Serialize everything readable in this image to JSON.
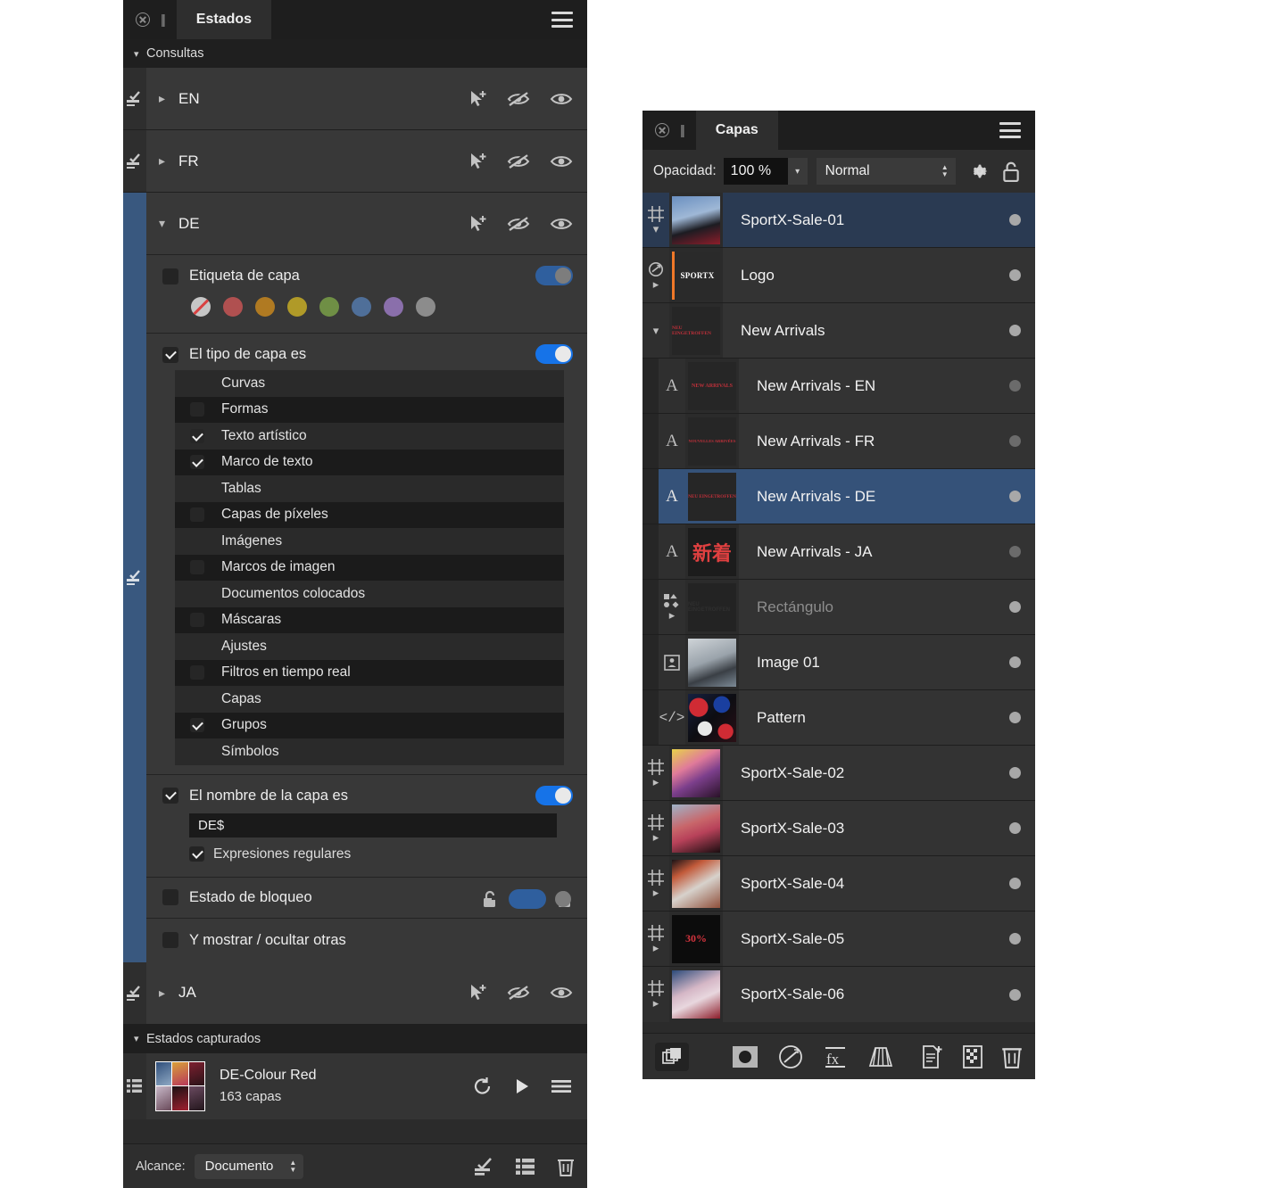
{
  "estados_panel": {
    "tab_title": "Estados",
    "sections": {
      "queries_header": "Consultas",
      "captured_header": "Estados capturados"
    },
    "queries": [
      {
        "name": "EN",
        "expanded": false,
        "selected": false
      },
      {
        "name": "FR",
        "expanded": false,
        "selected": false
      },
      {
        "name": "DE",
        "expanded": true,
        "selected": true
      },
      {
        "name": "JA",
        "expanded": false,
        "selected": false
      }
    ],
    "de_conditions": {
      "layer_label": {
        "label": "Etiqueta de capa",
        "checked": false,
        "toggle_on": false,
        "swatches": [
          "none",
          "#b05050",
          "#b07a22",
          "#b09a28",
          "#6f8f45",
          "#4f6f99",
          "#8a6fab",
          "#8c8c8c"
        ]
      },
      "layer_type": {
        "label": "El tipo de capa es",
        "checked": true,
        "toggle_on": true,
        "items": [
          {
            "label": "Curvas",
            "checked": false
          },
          {
            "label": "Formas",
            "checked": false
          },
          {
            "label": "Texto artístico",
            "checked": true
          },
          {
            "label": "Marco de texto",
            "checked": true
          },
          {
            "label": "Tablas",
            "checked": false
          },
          {
            "label": "Capas de píxeles",
            "checked": false
          },
          {
            "label": "Imágenes",
            "checked": false
          },
          {
            "label": "Marcos de imagen",
            "checked": false
          },
          {
            "label": "Documentos colocados",
            "checked": false
          },
          {
            "label": "Máscaras",
            "checked": false
          },
          {
            "label": "Ajustes",
            "checked": false
          },
          {
            "label": "Filtros en tiempo real",
            "checked": false
          },
          {
            "label": "Capas",
            "checked": false
          },
          {
            "label": "Grupos",
            "checked": true
          },
          {
            "label": "Símbolos",
            "checked": false
          }
        ]
      },
      "layer_name": {
        "label": "El nombre de la capa es",
        "checked": true,
        "toggle_on": true,
        "value": "DE$",
        "regex_label": "Expresiones regulares",
        "regex_checked": true
      },
      "lock_state": {
        "label": "Estado de bloqueo",
        "checked": false,
        "toggle_on": false
      },
      "show_hide_others": {
        "label": "Y mostrar / ocultar otras",
        "checked": false
      }
    },
    "captured_state": {
      "title": "DE-Colour Red",
      "subtitle": "163 capas"
    },
    "footer": {
      "scope_label": "Alcance:",
      "scope_value": "Documento"
    }
  },
  "capas_panel": {
    "tab_title": "Capas",
    "opacity_label": "Opacidad:",
    "opacity_value": "100 %",
    "blend_mode": "Normal",
    "layers": [
      {
        "name": "SportX-Sale-01",
        "icon": "artboard-icon",
        "indent": 0,
        "selected": true,
        "dim": false,
        "twisty": "down",
        "thumb": "photo-blue"
      },
      {
        "name": "Logo",
        "icon": "symbol-icon",
        "indent": 0,
        "selected": false,
        "dim": false,
        "twisty": "right",
        "thumb": "sportx-logo"
      },
      {
        "name": "New Arrivals",
        "icon": "none",
        "indent": 0,
        "selected": false,
        "dim": false,
        "twisty": "down",
        "thumb": "neu-eingetroffen"
      },
      {
        "name": "New Arrivals - EN",
        "icon": "text-icon",
        "indent": 1,
        "selected": false,
        "dim": false,
        "twisty": "none",
        "thumb": "new-arrivals"
      },
      {
        "name": "New Arrivals - FR",
        "icon": "text-icon",
        "indent": 1,
        "selected": false,
        "dim": false,
        "twisty": "none",
        "thumb": "nouvelles-arrivees"
      },
      {
        "name": "New Arrivals - DE",
        "icon": "text-icon",
        "indent": 1,
        "selected": true,
        "dim": false,
        "twisty": "none",
        "thumb": "neu-eingetroffen"
      },
      {
        "name": "New Arrivals - JA",
        "icon": "text-icon",
        "indent": 1,
        "selected": false,
        "dim": false,
        "twisty": "none",
        "thumb": "shinchaku"
      },
      {
        "name": "Rectángulo",
        "icon": "shapes-icon",
        "indent": 1,
        "selected": false,
        "dim": true,
        "twisty": "right",
        "thumb": "dark-empty"
      },
      {
        "name": "Image 01",
        "icon": "image-icon",
        "indent": 1,
        "selected": false,
        "dim": false,
        "twisty": "none",
        "thumb": "photo-street"
      },
      {
        "name": "Pattern",
        "icon": "code-icon",
        "indent": 1,
        "selected": false,
        "dim": false,
        "twisty": "none",
        "thumb": "pattern-collage"
      },
      {
        "name": "SportX-Sale-02",
        "icon": "artboard-icon",
        "indent": 0,
        "selected": false,
        "dim": false,
        "twisty": "right",
        "thumb": "sale-02"
      },
      {
        "name": "SportX-Sale-03",
        "icon": "artboard-icon",
        "indent": 0,
        "selected": false,
        "dim": false,
        "twisty": "right",
        "thumb": "sale-03"
      },
      {
        "name": "SportX-Sale-04",
        "icon": "artboard-icon",
        "indent": 0,
        "selected": false,
        "dim": false,
        "twisty": "right",
        "thumb": "sale-04"
      },
      {
        "name": "SportX-Sale-05",
        "icon": "artboard-icon",
        "indent": 0,
        "selected": false,
        "dim": false,
        "twisty": "right",
        "thumb": "sale-05"
      },
      {
        "name": "SportX-Sale-06",
        "icon": "artboard-icon",
        "indent": 0,
        "selected": false,
        "dim": false,
        "twisty": "right",
        "thumb": "sale-06"
      }
    ],
    "footer_icons": [
      "layer-stack-icon",
      "mask-icon",
      "adjustment-icon",
      "fx-icon",
      "blend-ranges-icon",
      "new-layer-icon",
      "new-mask-icon",
      "delete-icon"
    ]
  },
  "colors": {
    "panel_bg": "#2b2b2b",
    "row_bg": "#383838",
    "titlebar_bg": "#1e1e1e",
    "accent_blue": "#1673e8",
    "selection_blue": "#355279",
    "selection_blue_dark": "#2a3a52",
    "gutter_selected": "#39587f"
  }
}
